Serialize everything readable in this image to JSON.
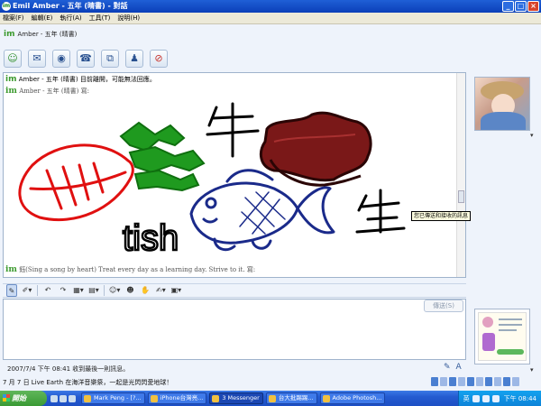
{
  "window": {
    "title": "Emil Amber - 五年 (晴書) - 對話",
    "app_icon_text": "im",
    "buttons": {
      "minimize": "_",
      "maximize": "□",
      "close": "×"
    }
  },
  "menu": [
    "檔案(F)",
    "編輯(E)",
    "執行(A)",
    "工具(T)",
    "說明(H)"
  ],
  "contact": {
    "logo": "im",
    "name": "Amber - 五年 (晴書)"
  },
  "toolbar": [
    {
      "name": "invite-icon",
      "glyph": "☺",
      "tone": "g"
    },
    {
      "name": "send-file-icon",
      "glyph": "✉",
      "tone": ""
    },
    {
      "name": "webcam-icon",
      "glyph": "◉",
      "tone": ""
    },
    {
      "name": "call-icon",
      "glyph": "☎",
      "tone": ""
    },
    {
      "name": "activities-icon",
      "glyph": "⧉",
      "tone": ""
    },
    {
      "name": "games-icon",
      "glyph": "♟",
      "tone": ""
    },
    {
      "name": "block-icon",
      "glyph": "⊘",
      "tone": "r"
    }
  ],
  "chat": {
    "status_name": "Amber - 五年 (晴書)",
    "status_text": "目前離開，可能無法回應。",
    "says_line": "Amber - 五年 (晴書) 寫:",
    "says_line2": "鈺(Sing a song by heart) Treat every day as a learning day. Strive to it. 寫:",
    "logo": "im",
    "drawing_text": "tish",
    "tooltip": "您已傳送和接收的訊息"
  },
  "format_toolbar": [
    {
      "name": "pen-icon",
      "glyph": "✎",
      "selected": true
    },
    {
      "name": "eraser-icon",
      "glyph": "✐▾",
      "selected": false
    },
    {
      "name": "undo-icon",
      "glyph": "↶",
      "selected": false
    },
    {
      "name": "redo-icon",
      "glyph": "↷",
      "selected": false
    },
    {
      "name": "color-icon",
      "glyph": "▦▾",
      "selected": false
    },
    {
      "name": "background-icon",
      "glyph": "▤▾",
      "selected": false
    },
    {
      "name": "emoticon-icon",
      "glyph": "☺▾",
      "selected": false
    },
    {
      "name": "wink-icon",
      "glyph": "☻",
      "selected": false
    },
    {
      "name": "nudge-icon",
      "glyph": "✋",
      "selected": false
    },
    {
      "name": "voice-clip-icon",
      "glyph": "✍▾",
      "selected": false
    },
    {
      "name": "wallpaper-icon",
      "glyph": "▣▾",
      "selected": false
    }
  ],
  "send_label": "傳送(S)",
  "last_message": "2007/7/4 下午 08:41 收到最後一則訊息。",
  "marquee": "7 月 7 日 Live Earth 在海洋音樂祭，一起是光閃閃愛地球！",
  "taskbar": {
    "start_label": "開始",
    "tasks": [
      {
        "label": "Mark Peng - [?...",
        "active": false
      },
      {
        "label": "iPhone台灣亮...",
        "active": false
      },
      {
        "label": "3 Messenger",
        "active": true
      },
      {
        "label": "台大批踢踢...",
        "active": false
      },
      {
        "label": "Adobe Photosh...",
        "active": false
      }
    ],
    "clock": "下午 08:44",
    "lang": "英"
  },
  "colors": {
    "accent": "#245bd0",
    "drawing_red": "#e01010",
    "drawing_green": "#1f9a1f",
    "drawing_navy": "#1a2a8a",
    "drawing_maroon": "#5a1010"
  }
}
